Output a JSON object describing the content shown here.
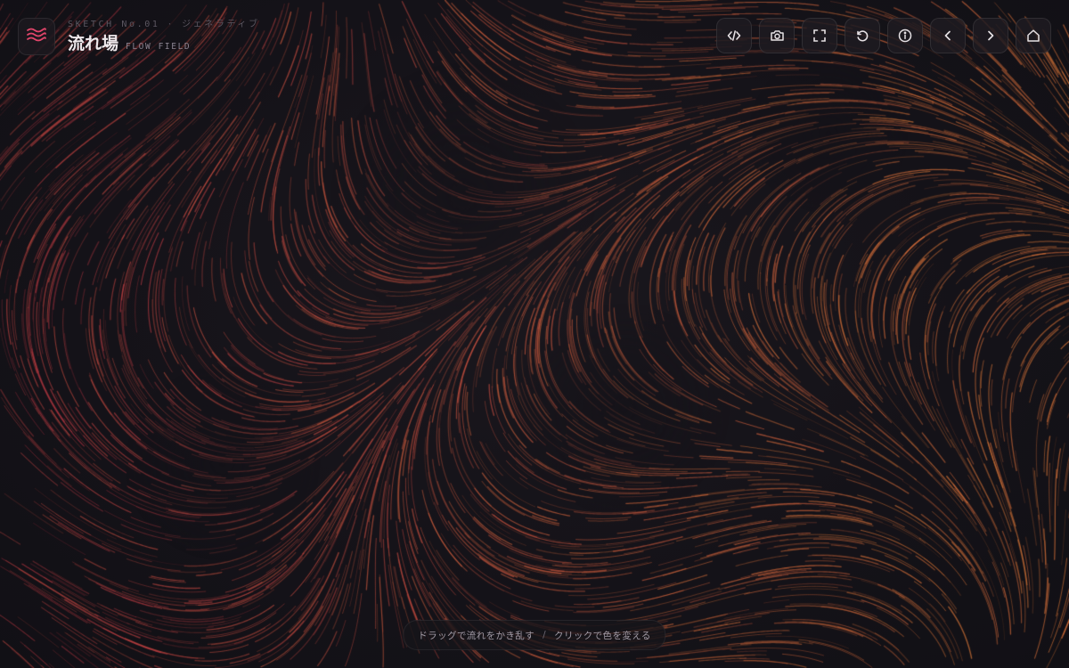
{
  "header": {
    "sketch_label": "SKETCH No.01",
    "separator": "·",
    "category": "ジェネラティブ",
    "title": "流れ場",
    "subtitle": "FLOW FIELD",
    "logo_icon": "waves-icon"
  },
  "toolbar": {
    "buttons": [
      {
        "icon": "code-icon",
        "name": "code-button"
      },
      {
        "icon": "camera-icon",
        "name": "screenshot-button"
      },
      {
        "icon": "fullscreen-icon",
        "name": "fullscreen-button"
      },
      {
        "icon": "reset-icon",
        "name": "reset-button"
      },
      {
        "icon": "info-icon",
        "name": "info-button"
      },
      {
        "icon": "chevron-left-icon",
        "name": "previous-button"
      },
      {
        "icon": "chevron-right-icon",
        "name": "next-button"
      },
      {
        "icon": "home-icon",
        "name": "home-button"
      }
    ]
  },
  "hint": {
    "drag": "ドラッグで流れをかき乱す",
    "separator": "/",
    "click": "クリックで色を変える"
  },
  "colors": {
    "background": "#141218",
    "accent": "#e0456a",
    "stroke_warm": "#f08a50",
    "stroke_red": "#c8344a",
    "icon": "#e6e1e4"
  }
}
